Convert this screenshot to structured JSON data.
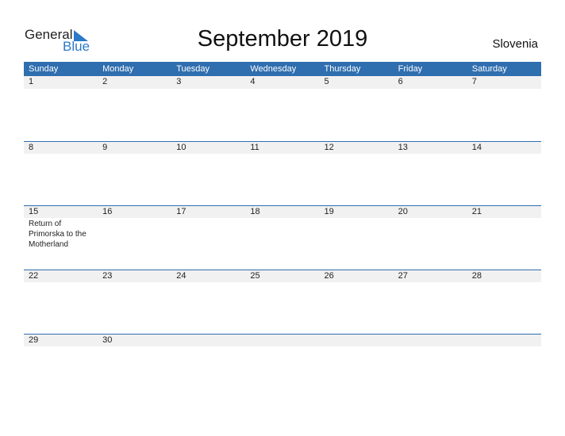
{
  "logo": {
    "general": "General",
    "blue": "Blue"
  },
  "title": "September 2019",
  "country": "Slovenia",
  "colors": {
    "header_bg": "#2f6eaf",
    "accent": "#2a7ac8",
    "date_strip": "#f1f1f1"
  },
  "weekdays": [
    "Sunday",
    "Monday",
    "Tuesday",
    "Wednesday",
    "Thursday",
    "Friday",
    "Saturday"
  ],
  "weeks": [
    {
      "days": [
        "1",
        "2",
        "3",
        "4",
        "5",
        "6",
        "7"
      ]
    },
    {
      "days": [
        "8",
        "9",
        "10",
        "11",
        "12",
        "13",
        "14"
      ]
    },
    {
      "days": [
        "15",
        "16",
        "17",
        "18",
        "19",
        "20",
        "21"
      ],
      "event": {
        "day_index": 0,
        "text": "Return of Primorska to the Motherland"
      }
    },
    {
      "days": [
        "22",
        "23",
        "24",
        "25",
        "26",
        "27",
        "28"
      ]
    },
    {
      "days": [
        "29",
        "30",
        "",
        "",
        "",
        "",
        ""
      ]
    }
  ]
}
